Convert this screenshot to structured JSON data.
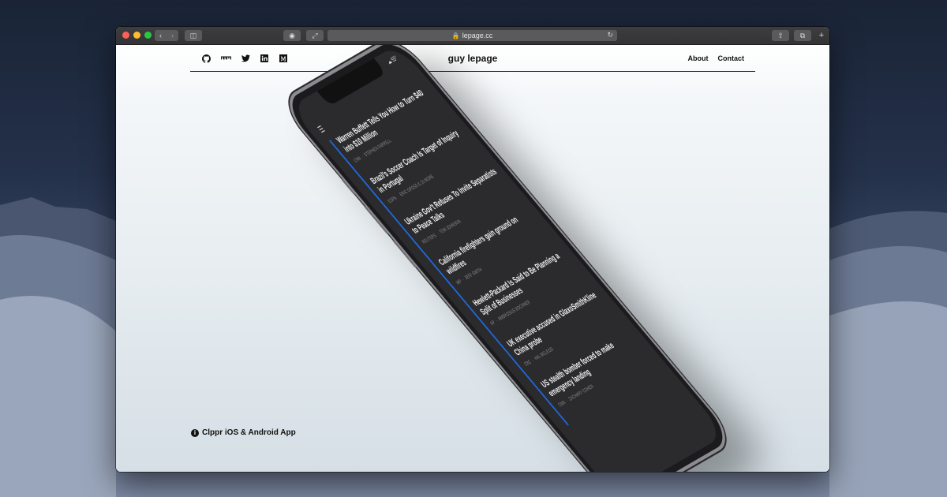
{
  "browser": {
    "address": "lepage.cc"
  },
  "site": {
    "title": "guy lepage",
    "nav": [
      "About",
      "Contact"
    ],
    "social_icons": [
      "github-icon",
      "npm-icon",
      "twitter-icon",
      "linkedin-icon",
      "medium-icon"
    ],
    "app_link": "Clppr iOS & Android App"
  },
  "phone": {
    "weather": "55°",
    "stories": [
      {
        "headline": "Warren Buffett Tells You How to Turn $40 into $10 Million",
        "source": "CNN",
        "author": "STEPHEN FARRELL"
      },
      {
        "headline": "Brazil's Soccer Coach Is Target of Inquiry in Portugal",
        "source": "ESPN",
        "author": "ERIC GROSS",
        "extra": "& 10 MORE"
      },
      {
        "headline": "Ukraine Gov't Refuses To Invite Separatists to Peace Talks",
        "source": "REUTERS",
        "author": "TOM JOHNSON"
      },
      {
        "headline": "California firefighters gain ground on wildfires",
        "source": "WP",
        "author": "JEFF SMITH"
      },
      {
        "headline": "Hewlett-Packard Is Said to Be Planning a Split of Businesses",
        "source": "AP",
        "author": "AMBROSIUS BOCHNER"
      },
      {
        "headline": "UK executive accused in GlaxoSmithKline China probe",
        "source": "CBC",
        "author": "HAL MCLEOD"
      },
      {
        "headline": "US stealth bomber forced to make emergency landing",
        "source": "CNN",
        "author": "ZACHARY COHEN"
      }
    ]
  },
  "colors": {
    "accent": "#1d6ce0",
    "screen_bg": "#2b2b2d"
  }
}
